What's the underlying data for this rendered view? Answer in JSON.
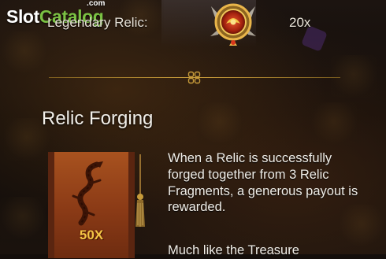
{
  "branding": {
    "watermark_slot": "Slot",
    "watermark_catalog": "Catalog",
    "watermark_tld": ".com"
  },
  "relic_row": {
    "label": "Legendary Relic:",
    "multiplier": "20x",
    "icon": "relic-emblem-icon"
  },
  "divider": {
    "icon": "knot-ornament-icon",
    "color": "#c79b3a"
  },
  "relic_forging": {
    "title": "Relic Forging",
    "scroll_multiplier": "50X",
    "scroll_icon": "dragon-scroll-icon",
    "paragraph": "When a Relic is successfully forged together from 3 Relic Fragments, a generous payout is rewarded.",
    "paragraph_next": "Much like the Treasure"
  },
  "colors": {
    "text": "#f1eee8",
    "gold": "#c79b3a",
    "brand_green": "#7ac143",
    "scroll": "#a8521f"
  }
}
